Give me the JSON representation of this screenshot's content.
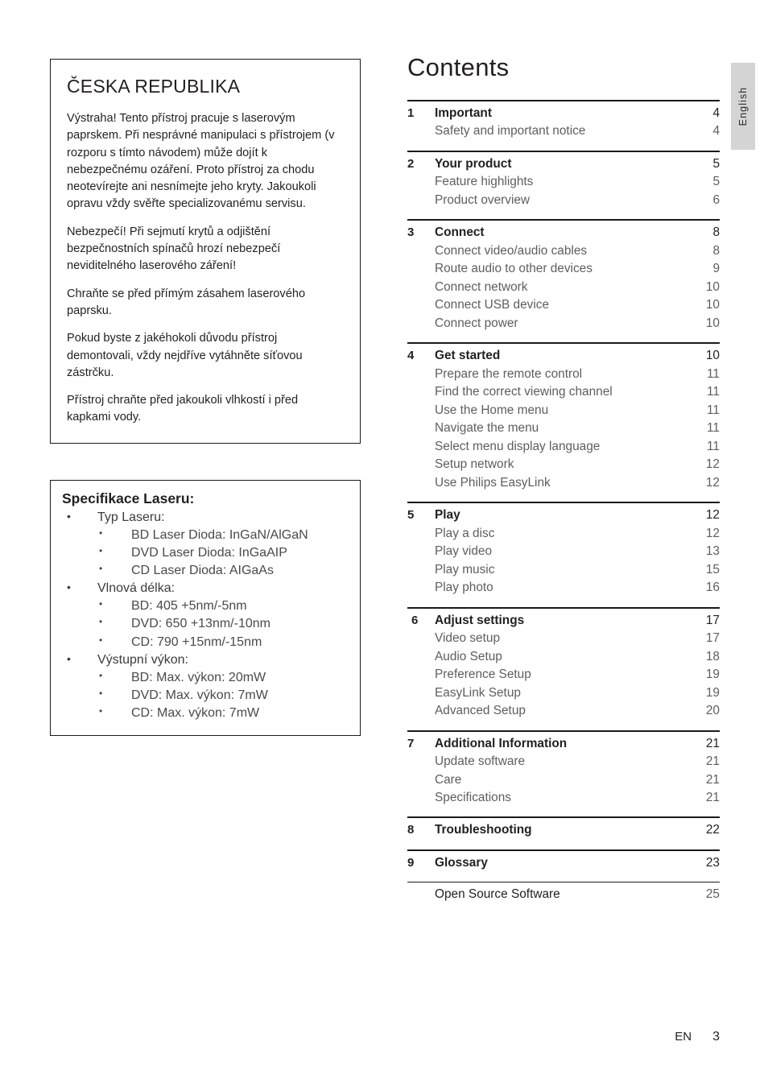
{
  "notice": {
    "title": "ČESKA REPUBLIKA",
    "paragraphs": [
      "Výstraha! Tento přístroj pracuje s laserovým paprskem. Při nesprávné manipulaci s přístrojem (v rozporu s tímto návodem) může dojít k nebezpečnému ozáření. Proto přístroj za chodu neotevírejte ani nesnímejte jeho kryty. Jakoukoli opravu vždy svěřte specializovanému servisu.",
      "Nebezpečí! Při sejmutí krytů a odjištění bezpečnostních spínačů hrozí nebezpečí neviditelného laserového záření!",
      "Chraňte se před přímým zásahem laserového paprsku.",
      "Pokud byste z jakéhokoli důvodu přístroj demontovali, vždy nejdříve vytáhněte síťovou zástrčku.",
      "Přístroj chraňte před jakoukoli vlhkostí i před kapkami vody."
    ]
  },
  "laser_spec": {
    "title": "Specifikace Laseru:",
    "groups": [
      {
        "label": "Typ Laseru:",
        "items": [
          "BD Laser Dioda: InGaN/AlGaN",
          "DVD Laser Dioda:  InGaAIP",
          "CD Laser Dioda: AIGaAs"
        ]
      },
      {
        "label": "Vlnová délka:",
        "items": [
          "BD:  405 +5nm/-5nm",
          "DVD:  650 +13nm/-10nm",
          "CD:  790 +15nm/-15nm"
        ]
      },
      {
        "label": "Výstupní výkon:",
        "items": [
          "BD:  Max. výkon: 20mW",
          "DVD:  Max. výkon: 7mW",
          "CD:  Max. výkon: 7mW"
        ]
      }
    ],
    "bullet_glyph": "•"
  },
  "contents": {
    "title": "Contents",
    "groups": [
      {
        "number": "1",
        "title": "Important",
        "page": "4",
        "subitems": [
          {
            "label": "Safety and important notice",
            "page": "4"
          }
        ]
      },
      {
        "number": "2",
        "title": "Your product",
        "page": "5",
        "subitems": [
          {
            "label": "Feature highlights",
            "page": "5"
          },
          {
            "label": "Product overview",
            "page": "6"
          }
        ]
      },
      {
        "number": "3",
        "title": "Connect",
        "page": "8",
        "subitems": [
          {
            "label": "Connect video/audio cables",
            "page": "8"
          },
          {
            "label": "Route audio to other devices",
            "page": "9"
          },
          {
            "label": "Connect network",
            "page": "10"
          },
          {
            "label": "Connect USB device",
            "page": "10"
          },
          {
            "label": "Connect power",
            "page": "10"
          }
        ]
      },
      {
        "number": "4",
        "title": "Get started",
        "page": "10",
        "subitems": [
          {
            "label": "Prepare the remote control",
            "page": "11"
          },
          {
            "label": "Find the correct viewing channel",
            "page": "11"
          },
          {
            "label": "Use the Home menu",
            "page": "11"
          },
          {
            "label": "Navigate the menu",
            "page": "11"
          },
          {
            "label": "Select menu display language",
            "page": "11"
          },
          {
            "label": "Setup network",
            "page": "12"
          },
          {
            "label": "Use Philips EasyLink",
            "page": "12"
          }
        ]
      },
      {
        "number": "5",
        "title": "Play",
        "page": "12",
        "subitems": [
          {
            "label": "Play a disc",
            "page": "12"
          },
          {
            "label": "Play video",
            "page": "13"
          },
          {
            "label": "Play music",
            "page": "15"
          },
          {
            "label": "Play photo",
            "page": "16"
          }
        ]
      },
      {
        "number": "6",
        "title": "Adjust settings",
        "page": "17",
        "subitems": [
          {
            "label": "Video setup",
            "page": "17"
          },
          {
            "label": "Audio Setup",
            "page": "18"
          },
          {
            "label": "Preference Setup",
            "page": "19"
          },
          {
            "label": "EasyLink Setup",
            "page": "19"
          },
          {
            "label": "Advanced Setup",
            "page": "20"
          }
        ]
      },
      {
        "number": "7",
        "title": "Additional Information",
        "page": "21",
        "subitems": [
          {
            "label": "Update software",
            "page": "21"
          },
          {
            "label": "Care",
            "page": "21"
          },
          {
            "label": "Specifications",
            "page": "21"
          }
        ]
      },
      {
        "number": "8",
        "title": "Troubleshooting",
        "page": "22",
        "subitems": []
      },
      {
        "number": "9",
        "title": "Glossary",
        "page": "23",
        "subitems": []
      }
    ],
    "extra": {
      "label": "Open Source Software",
      "page": "25"
    }
  },
  "language_tab": {
    "label": "English"
  },
  "footer": {
    "language_code": "EN",
    "page_number": "3"
  }
}
